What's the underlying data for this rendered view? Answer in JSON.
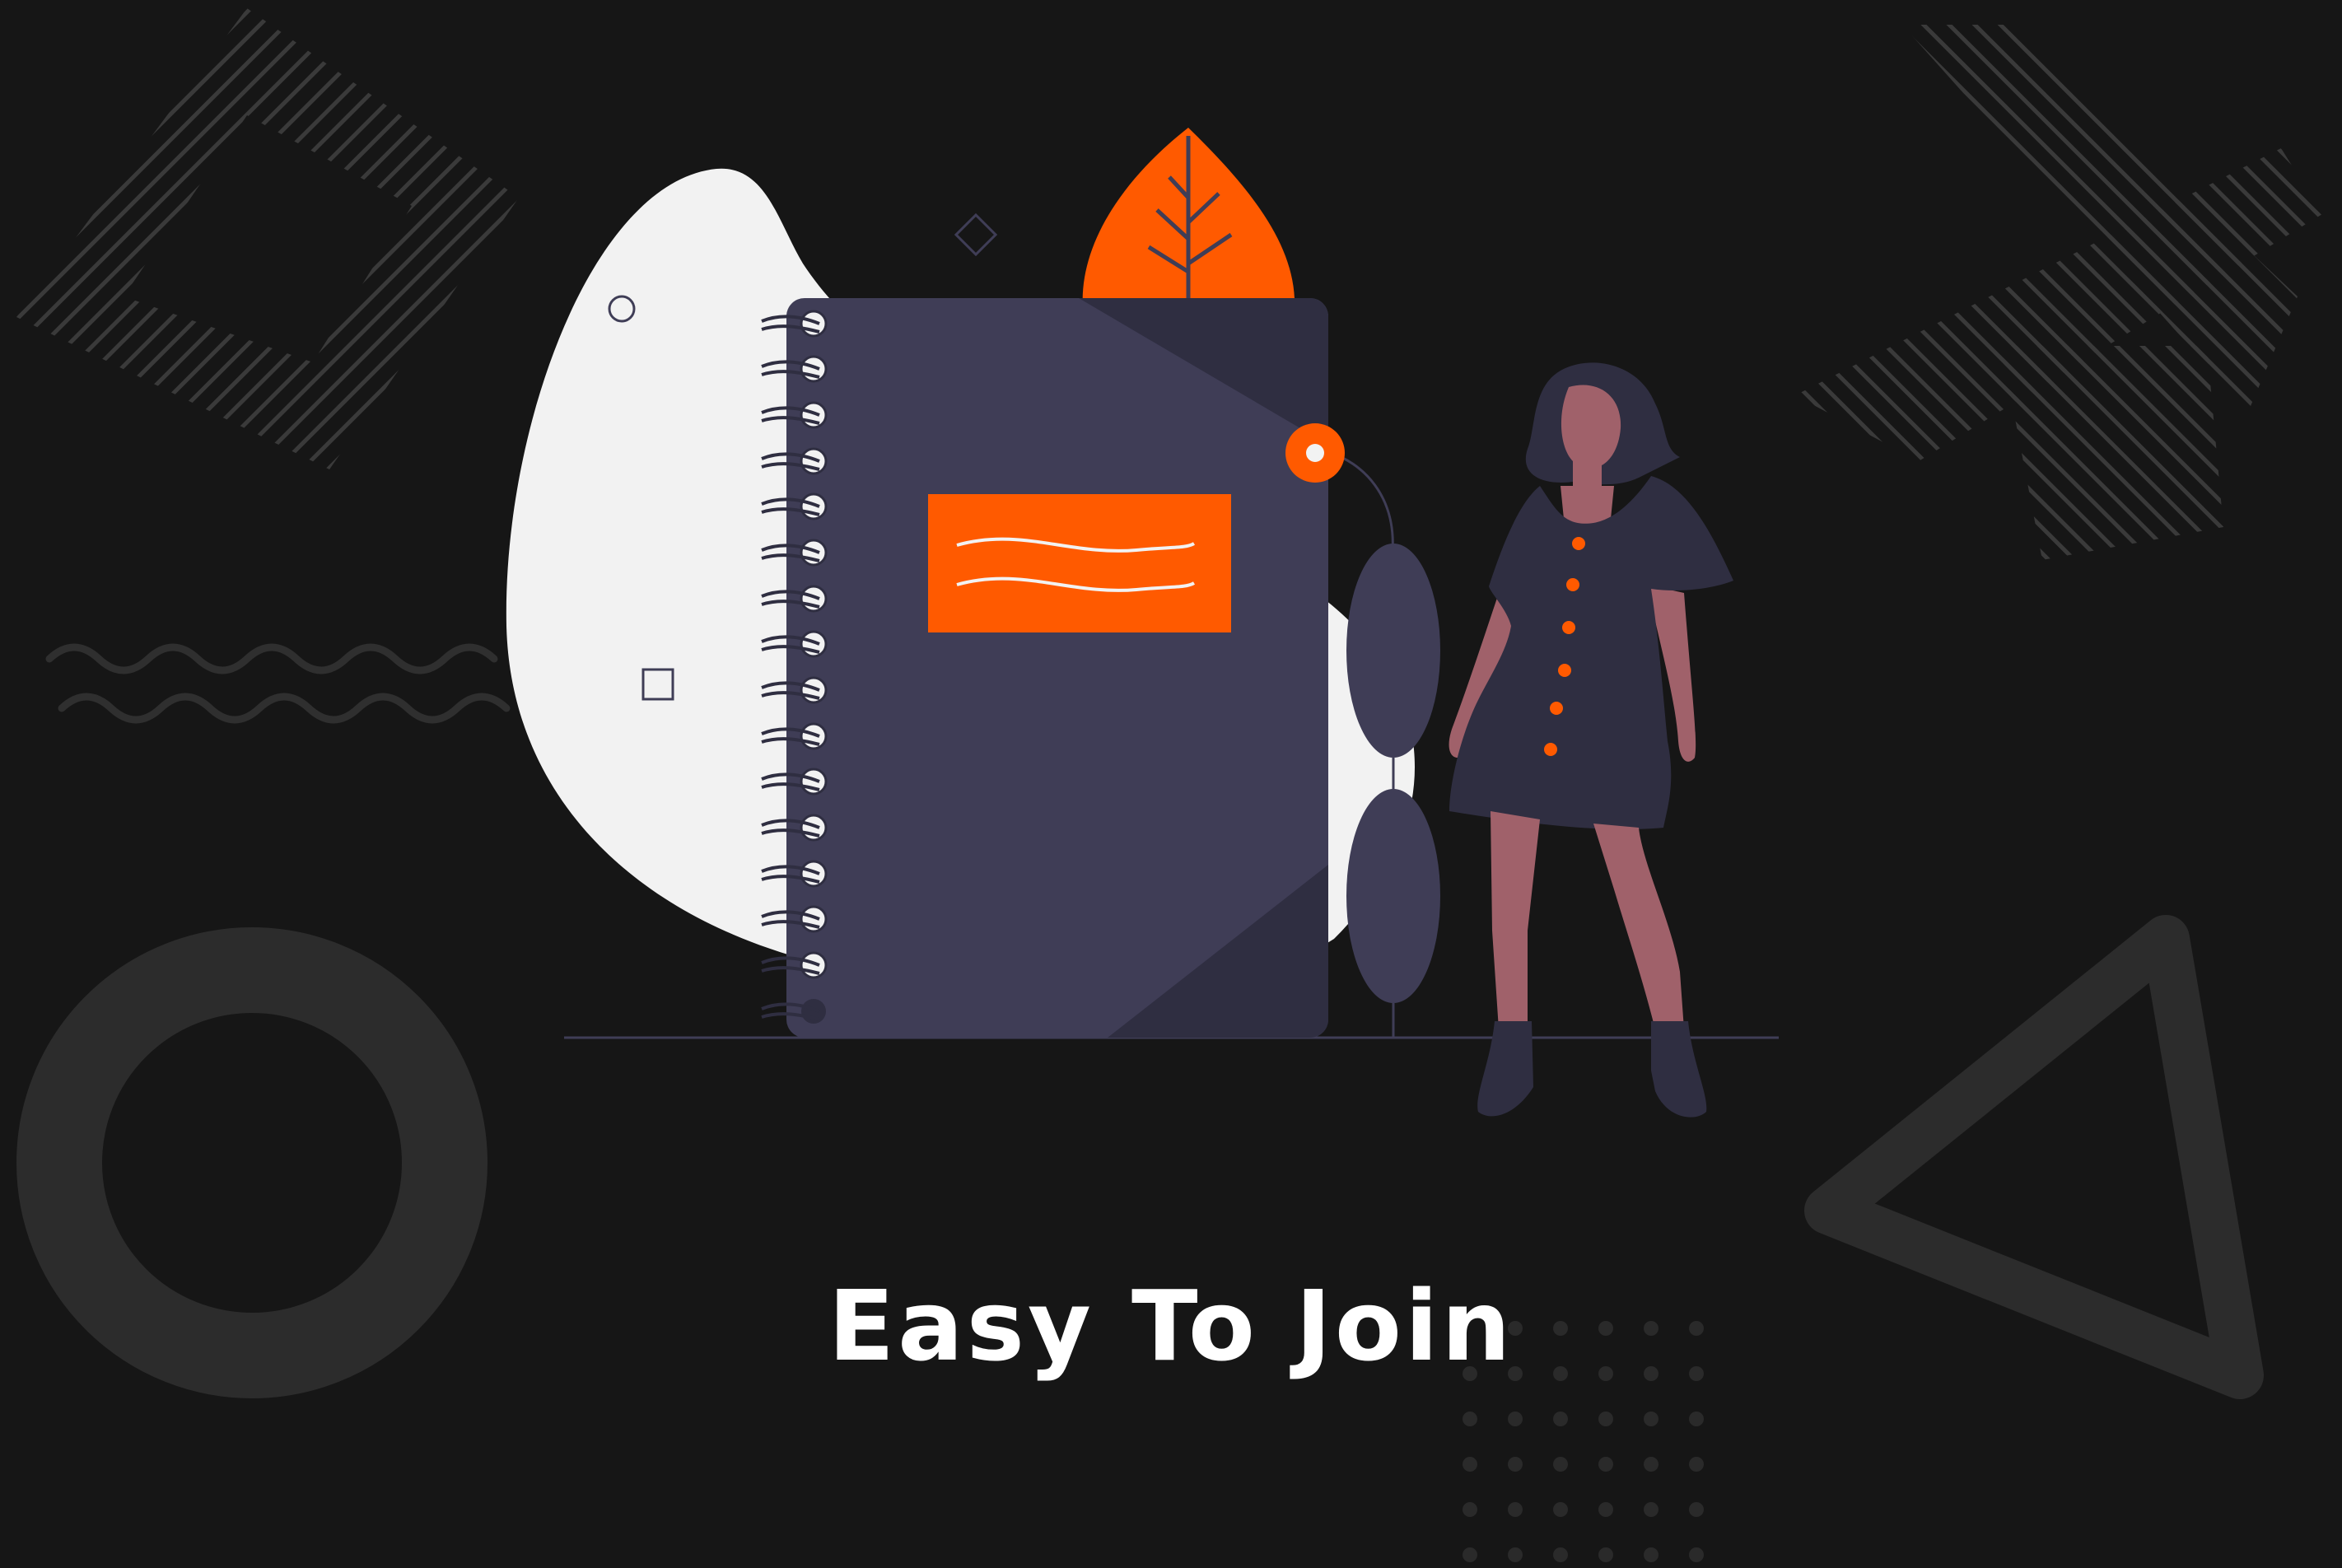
{
  "hero": {
    "title": "Easy To Join"
  },
  "illustration": {
    "subject": "woman-standing-beside-notebook-icon"
  },
  "colors": {
    "background": "#161616",
    "accent": "#ff5a00",
    "notebook": "#3f3d56",
    "shape_gray": "#2c2c2c",
    "blob": "#f2f2f2",
    "skin": "#a0616a"
  }
}
